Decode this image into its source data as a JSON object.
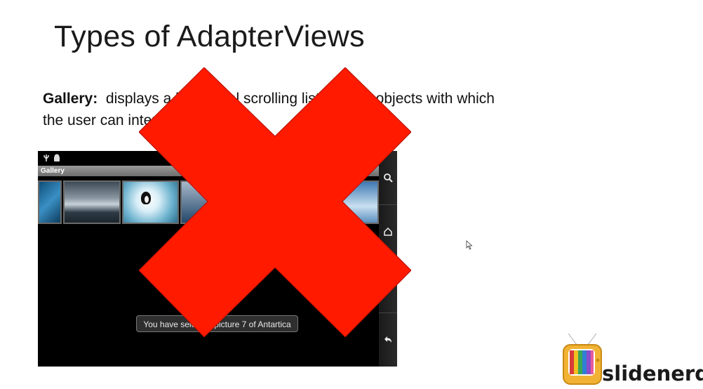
{
  "slide": {
    "title": "Types of AdapterViews",
    "term": "Gallery:",
    "description_line1": "displays a horizontal scrolling list of View objects with which",
    "description_line2": "the user can interact"
  },
  "device": {
    "action_bar_title": "Gallery",
    "toast_text": "You have selected picture 7 of Antartica",
    "nav_buttons": [
      "search-icon",
      "home-icon",
      "back-icon"
    ]
  },
  "overlay": {
    "x_color": "#ff1a00"
  },
  "logo": {
    "text": "slidenerd"
  }
}
